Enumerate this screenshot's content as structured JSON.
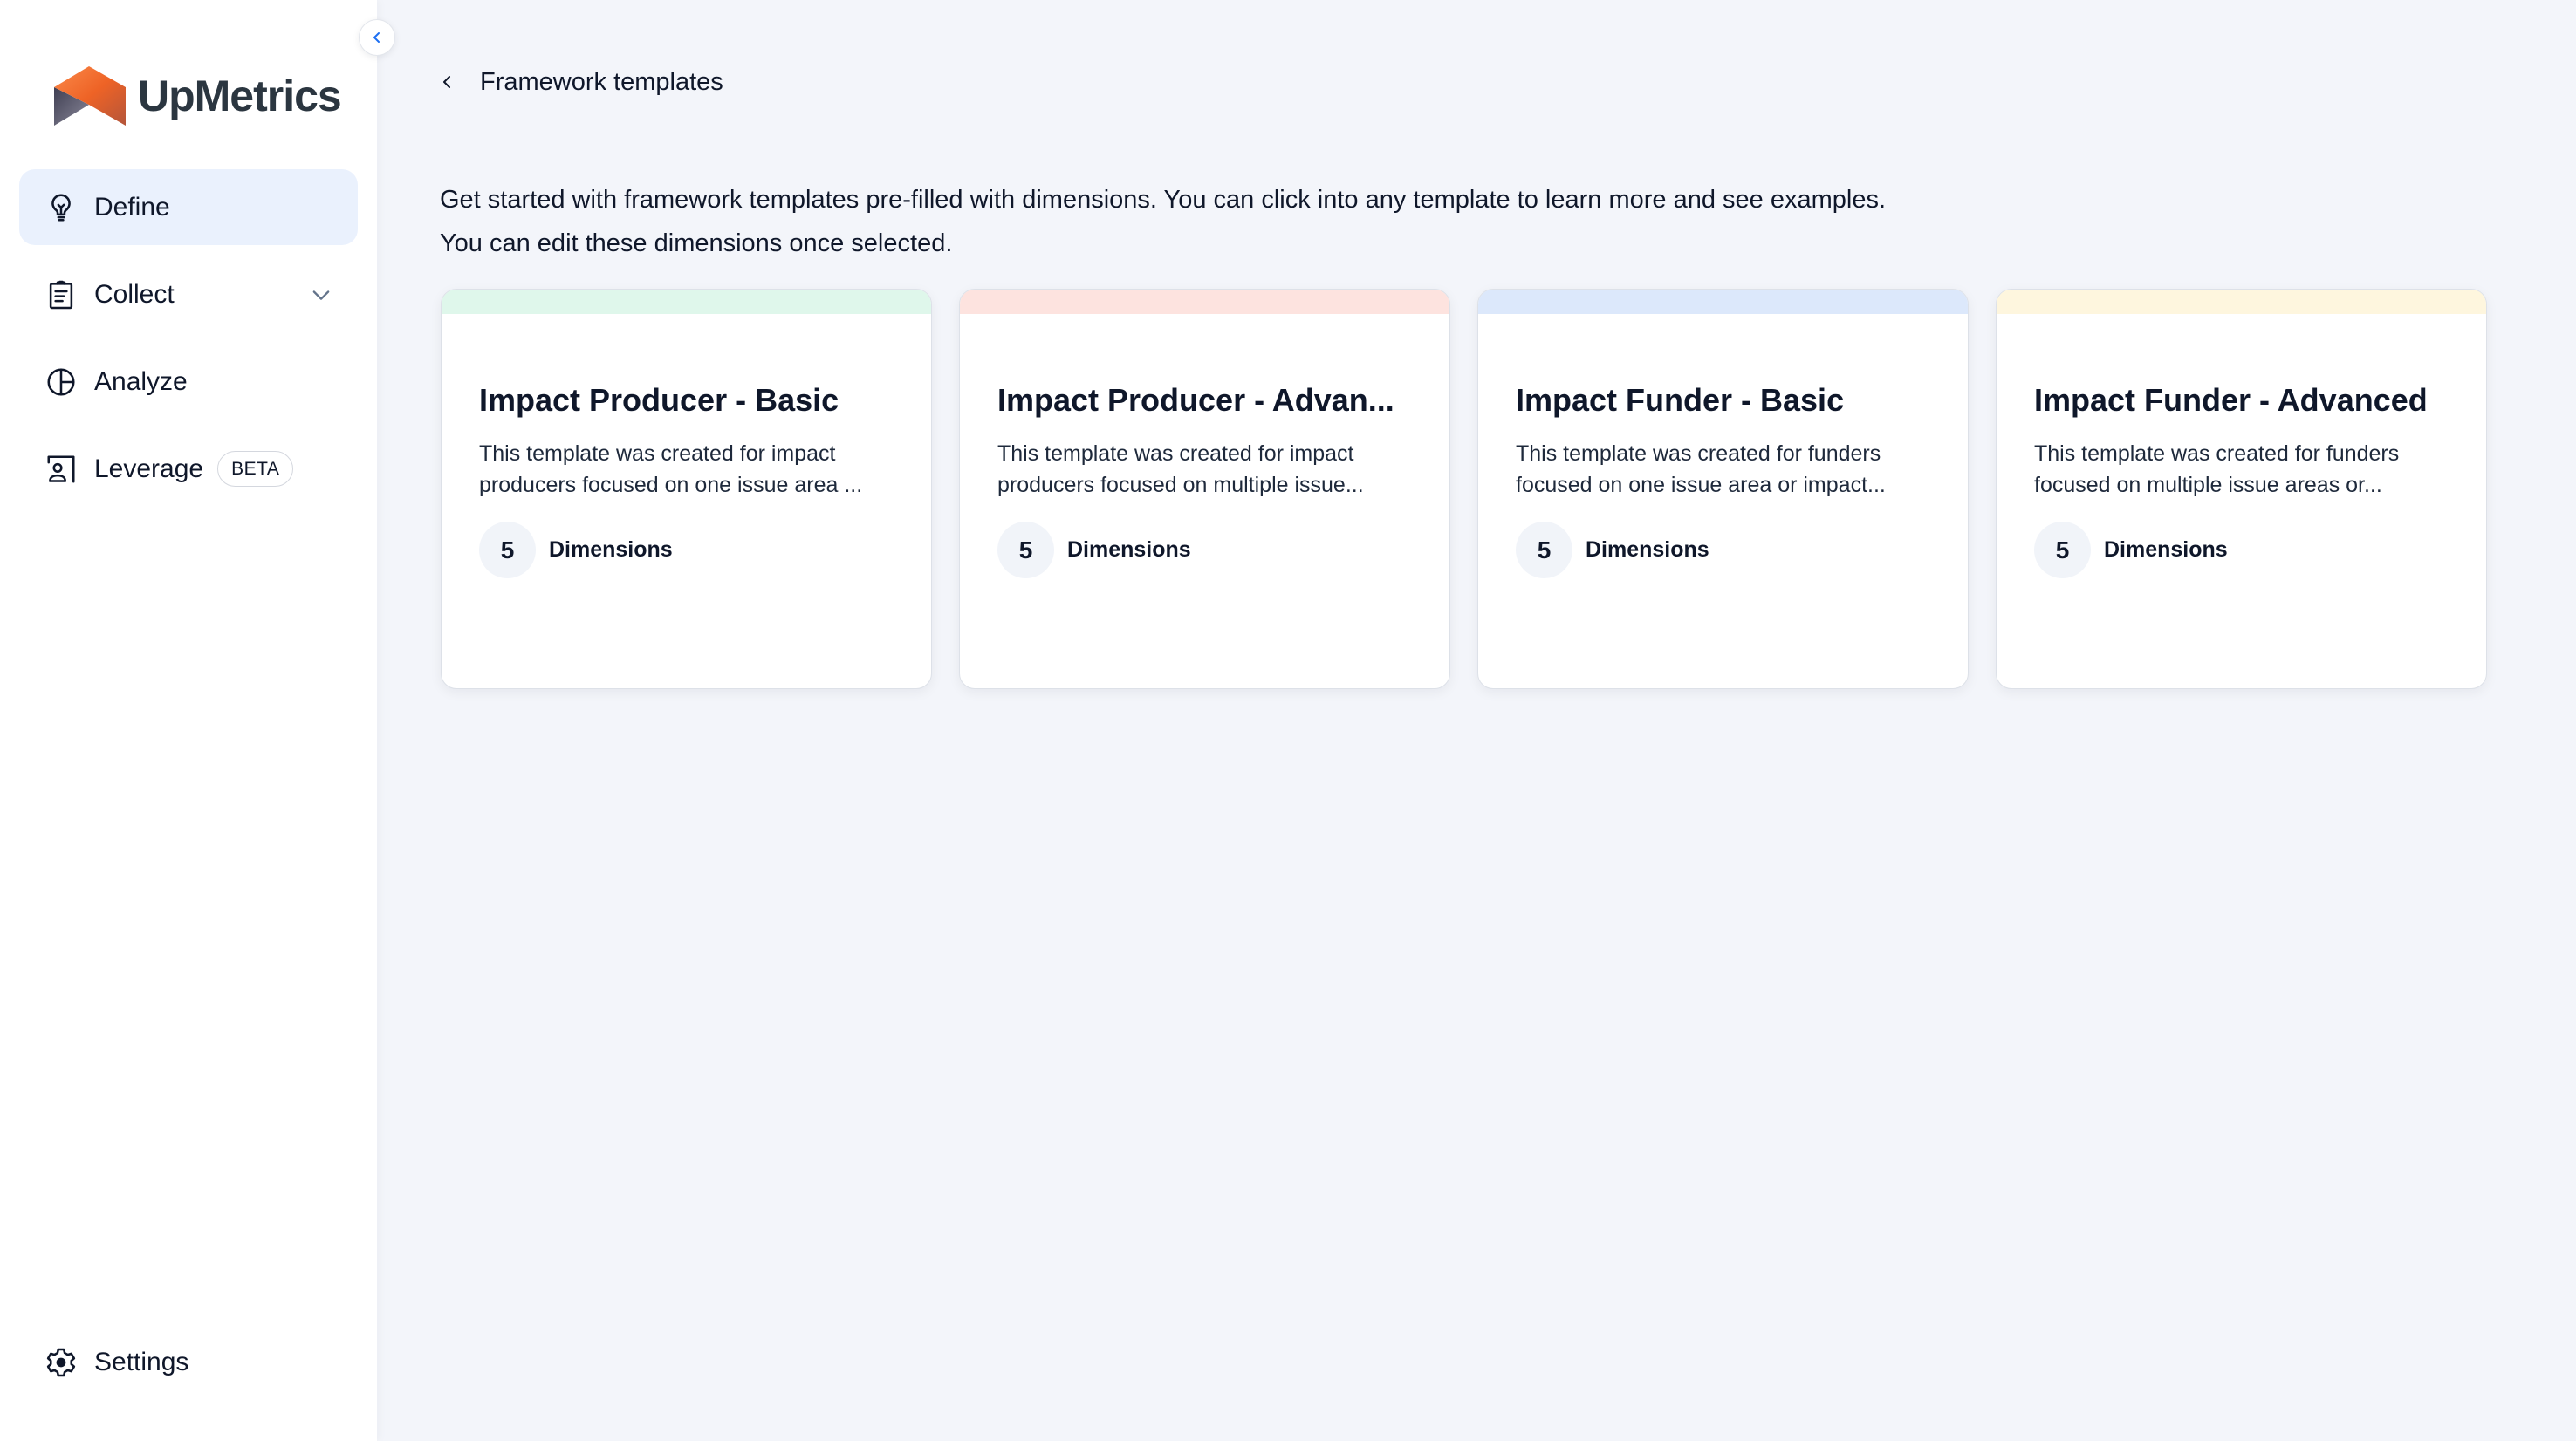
{
  "app": {
    "brand_name": "UpMetrics",
    "logo_colors": {
      "orange": "#f06a2a",
      "gray": "#7d7b8c"
    }
  },
  "sidebar": {
    "collapse_icon": "chevron-left-icon",
    "items": [
      {
        "label": "Define",
        "icon": "lightbulb-icon",
        "active": true
      },
      {
        "label": "Collect",
        "icon": "clipboard-icon",
        "has_dropdown": true
      },
      {
        "label": "Analyze",
        "icon": "pie-chart-icon"
      },
      {
        "label": "Leverage",
        "icon": "user-card-icon",
        "badge": "BETA"
      }
    ],
    "footer_item": {
      "label": "Settings",
      "icon": "gear-icon"
    }
  },
  "header": {
    "back_icon": "chevron-left-icon",
    "title": "Framework templates"
  },
  "intro": {
    "line1": "Get started with framework templates pre-filled with dimensions. You can click into any template to learn more and see examples.",
    "line2": "You can edit these dimensions once selected."
  },
  "cards": [
    {
      "title": "Impact Producer - Basic",
      "description": "This template was created for impact producers focused on one issue area ...",
      "dimensions_count": "5",
      "dimensions_label": "Dimensions",
      "accent_color": "#dff7eb"
    },
    {
      "title": "Impact Producer - Advan...",
      "description": "This template was created for impact producers focused on multiple issue...",
      "dimensions_count": "5",
      "dimensions_label": "Dimensions",
      "accent_color": "#fde3df"
    },
    {
      "title": "Impact Funder - Basic",
      "description": "This template was created for funders focused on one issue area or impact...",
      "dimensions_count": "5",
      "dimensions_label": "Dimensions",
      "accent_color": "#dce8fb"
    },
    {
      "title": "Impact Funder - Advanced",
      "description": "This template was created for funders focused on multiple issue areas or...",
      "dimensions_count": "5",
      "dimensions_label": "Dimensions",
      "accent_color": "#fef6de"
    }
  ]
}
